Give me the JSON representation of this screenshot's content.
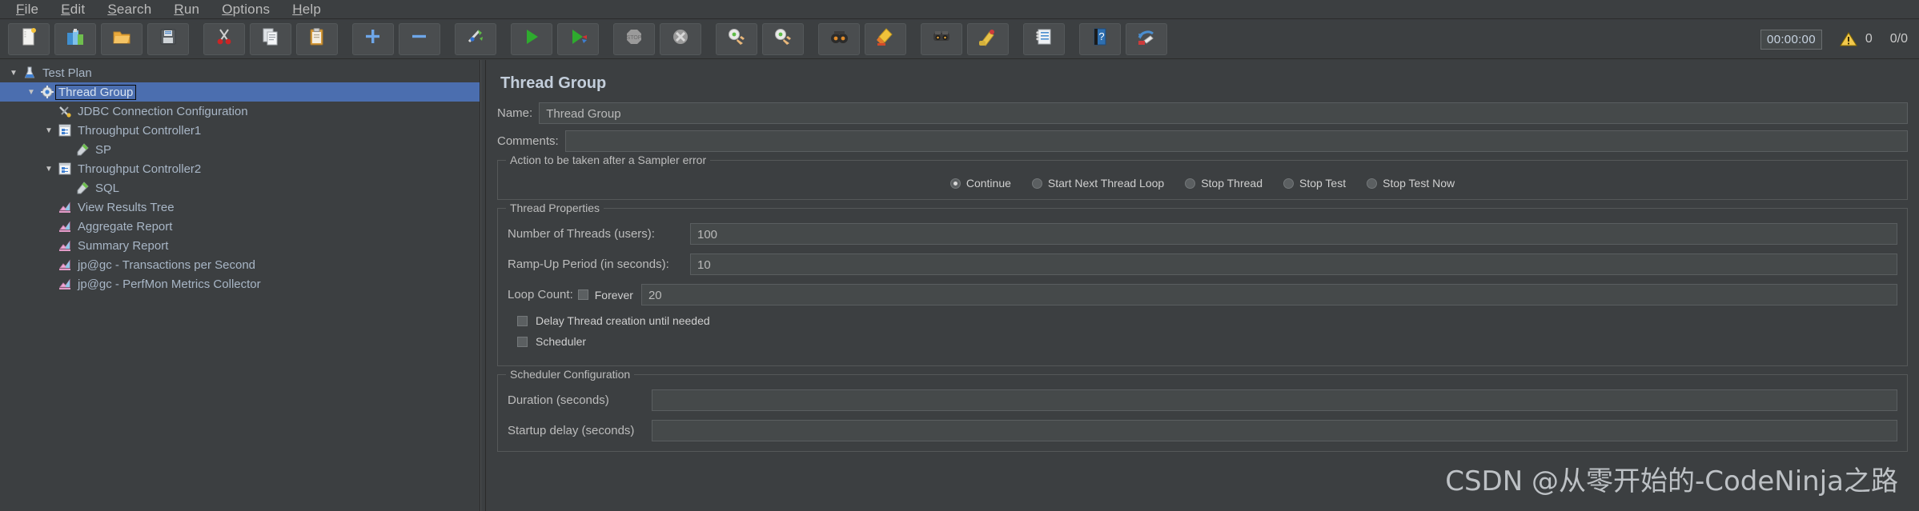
{
  "menu": {
    "items": [
      {
        "label": "File",
        "mnemonic": "F"
      },
      {
        "label": "Edit",
        "mnemonic": "E"
      },
      {
        "label": "Search",
        "mnemonic": "S"
      },
      {
        "label": "Run",
        "mnemonic": "R"
      },
      {
        "label": "Options",
        "mnemonic": "O"
      },
      {
        "label": "Help",
        "mnemonic": "H"
      }
    ]
  },
  "toolbar": {
    "buttons": [
      {
        "name": "new-icon",
        "title": "New"
      },
      {
        "name": "templates-icon",
        "title": "Templates"
      },
      {
        "name": "open-icon",
        "title": "Open"
      },
      {
        "name": "save-icon",
        "title": "Save"
      },
      {
        "name": "cut-icon",
        "title": "Cut"
      },
      {
        "name": "copy-icon",
        "title": "Copy"
      },
      {
        "name": "paste-icon",
        "title": "Paste"
      },
      {
        "name": "expand-all-icon",
        "title": "Expand All"
      },
      {
        "name": "collapse-all-icon",
        "title": "Collapse All"
      },
      {
        "name": "toggle-icon",
        "title": "Toggle"
      },
      {
        "name": "start-icon",
        "title": "Start"
      },
      {
        "name": "start-no-pauses-icon",
        "title": "Start no pauses"
      },
      {
        "name": "stop-icon",
        "title": "Stop"
      },
      {
        "name": "shutdown-icon",
        "title": "Shutdown"
      },
      {
        "name": "remote-start-all-icon",
        "title": "Remote Start All"
      },
      {
        "name": "remote-stop-all-icon",
        "title": "Remote Stop All"
      },
      {
        "name": "clear-icon",
        "title": "Clear"
      },
      {
        "name": "clear-all-icon",
        "title": "Clear All"
      },
      {
        "name": "search-icon",
        "title": "Search"
      },
      {
        "name": "reset-search-icon",
        "title": "Reset Search"
      },
      {
        "name": "function-helper-icon",
        "title": "Function Helper Dialog"
      },
      {
        "name": "help-icon",
        "title": "Help"
      },
      {
        "name": "undo-icon",
        "title": "Undo"
      }
    ],
    "timer": "00:00:00",
    "warning_count": "0",
    "thread_count": "0/0"
  },
  "tree": {
    "items": [
      {
        "label": "Test Plan",
        "indent": 0,
        "twisty": "open",
        "icon": "test-plan-icon",
        "selected": false
      },
      {
        "label": "Thread Group",
        "indent": 1,
        "twisty": "open",
        "icon": "thread-group-icon",
        "selected": true
      },
      {
        "label": "JDBC Connection Configuration",
        "indent": 2,
        "twisty": "none",
        "icon": "config-element-icon",
        "selected": false
      },
      {
        "label": "Throughput Controller1",
        "indent": 2,
        "twisty": "open",
        "icon": "controller-icon",
        "selected": false
      },
      {
        "label": "SP",
        "indent": 3,
        "twisty": "none",
        "icon": "sampler-icon",
        "selected": false
      },
      {
        "label": "Throughput Controller2",
        "indent": 2,
        "twisty": "open",
        "icon": "controller-icon",
        "selected": false
      },
      {
        "label": "SQL",
        "indent": 3,
        "twisty": "none",
        "icon": "sampler-icon",
        "selected": false
      },
      {
        "label": "View Results Tree",
        "indent": 2,
        "twisty": "none",
        "icon": "listener-icon",
        "selected": false
      },
      {
        "label": "Aggregate Report",
        "indent": 2,
        "twisty": "none",
        "icon": "listener-icon",
        "selected": false
      },
      {
        "label": "Summary Report",
        "indent": 2,
        "twisty": "none",
        "icon": "listener-icon",
        "selected": false
      },
      {
        "label": "jp@gc - Transactions per Second",
        "indent": 2,
        "twisty": "none",
        "icon": "listener-icon",
        "selected": false
      },
      {
        "label": "jp@gc - PerfMon Metrics Collector",
        "indent": 2,
        "twisty": "none",
        "icon": "listener-icon",
        "selected": false
      }
    ]
  },
  "panel": {
    "title": "Thread Group",
    "name_label": "Name:",
    "name_value": "Thread Group",
    "comments_label": "Comments:",
    "comments_value": "",
    "error_action": {
      "legend": "Action to be taken after a Sampler error",
      "options": [
        {
          "label": "Continue",
          "selected": true
        },
        {
          "label": "Start Next Thread Loop",
          "selected": false
        },
        {
          "label": "Stop Thread",
          "selected": false
        },
        {
          "label": "Stop Test",
          "selected": false
        },
        {
          "label": "Stop Test Now",
          "selected": false
        }
      ]
    },
    "thread_properties": {
      "legend": "Thread Properties",
      "threads_label": "Number of Threads (users):",
      "threads_value": "100",
      "rampup_label": "Ramp-Up Period (in seconds):",
      "rampup_value": "10",
      "loop_label": "Loop Count:",
      "forever_label": "Forever",
      "forever_checked": false,
      "loop_value": "20",
      "delay_label": "Delay Thread creation until needed",
      "delay_checked": false,
      "scheduler_label": "Scheduler",
      "scheduler_checked": false
    },
    "scheduler_config": {
      "legend": "Scheduler Configuration",
      "duration_label": "Duration (seconds)",
      "duration_value": "",
      "startup_label": "Startup delay (seconds)",
      "startup_value": ""
    }
  },
  "watermark": "CSDN @从零开始的-CodeNinja之路",
  "colors": {
    "background": "#3c3f41",
    "selection": "#4b6eaf",
    "text": "#bcbcbc",
    "tree_text": "#a8b6c6",
    "accent_title": "#c3cedb"
  }
}
